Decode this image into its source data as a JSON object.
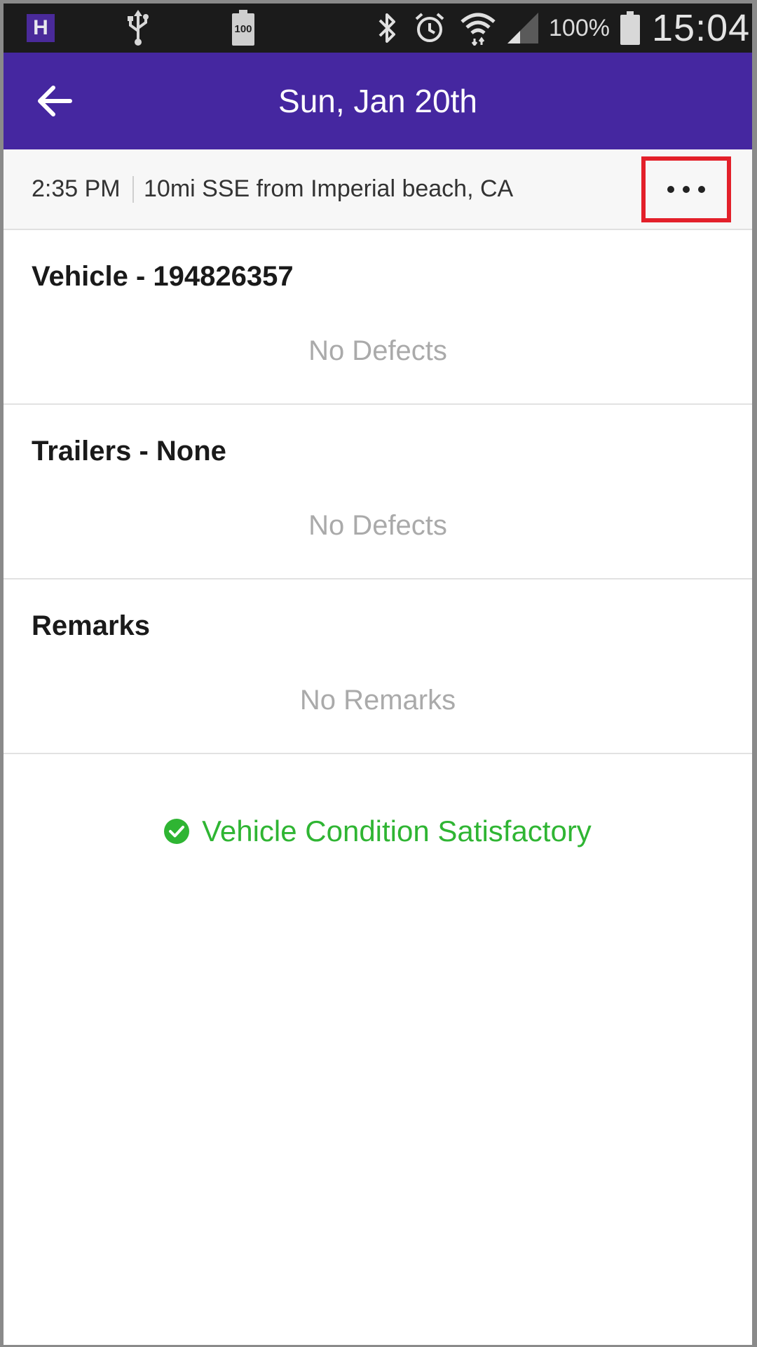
{
  "status_bar": {
    "app_badge": "H",
    "battery_low_label": "100",
    "battery_percent": "100%",
    "time": "15:04"
  },
  "app_bar": {
    "title": "Sun, Jan 20th"
  },
  "info": {
    "time": "2:35 PM",
    "location": "10mi SSE from Imperial beach, CA"
  },
  "sections": {
    "vehicle": {
      "title": "Vehicle - 194826357",
      "value": "No Defects"
    },
    "trailers": {
      "title": "Trailers - None",
      "value": "No Defects"
    },
    "remarks": {
      "title": "Remarks",
      "value": "No Remarks"
    }
  },
  "condition": {
    "text": "Vehicle Condition Satisfactory"
  },
  "colors": {
    "app_bar": "#4527a0",
    "status_bar": "#1b1b1b",
    "success": "#2fb533",
    "highlight": "#e3202a"
  }
}
